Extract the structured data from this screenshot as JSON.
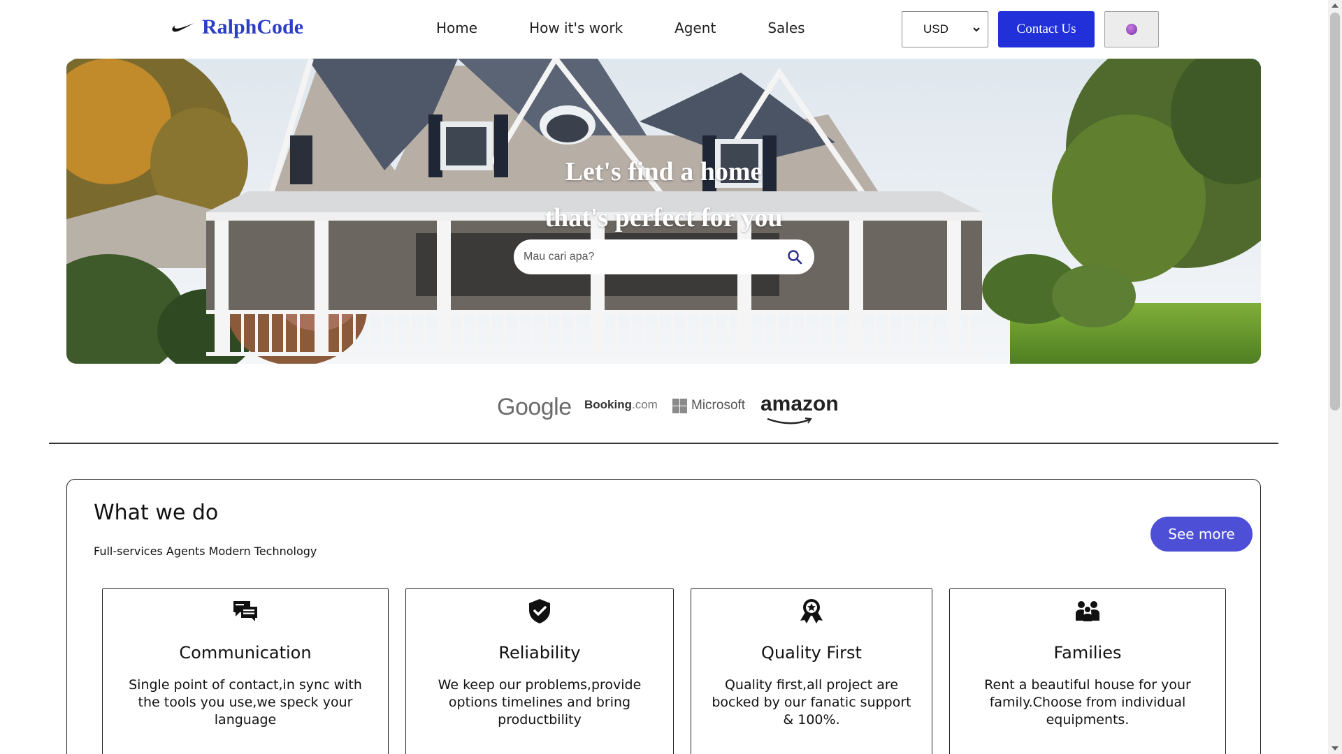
{
  "nav": {
    "brand": "RalphCode",
    "brand_icon": "swoosh-icon",
    "menu": [
      "Home",
      "How it's work",
      "Agent",
      "Sales"
    ],
    "currency": {
      "selected": "USD"
    },
    "contact_label": "Contact Us",
    "theme_icon": "globe-icon"
  },
  "hero": {
    "title_line1": "Let's find a home",
    "title_line2": "that's perfect for you",
    "search_placeholder": "Mau cari apa?",
    "search_icon": "search-icon"
  },
  "partners": {
    "google": "Google",
    "booking": "Booking",
    "booking_suffix": ".com",
    "microsoft": "Microsoft",
    "amazon": "amazon"
  },
  "services": {
    "title": "What we do",
    "subtitle": "Full-services Agents Modern Technology",
    "see_more": "See more",
    "cards": [
      {
        "icon": "chat-icon",
        "title": "Communication",
        "text": "Single point of contact,in sync with the tools you use,we speck your language"
      },
      {
        "icon": "shield-check-icon",
        "title": "Reliability",
        "text": "We keep our problems,provide options timelines and bring productbility"
      },
      {
        "icon": "award-icon",
        "title": "Quality First",
        "text": "Quality first,all project are bocked by our fanatic support & 100%."
      },
      {
        "icon": "family-icon",
        "title": "Families",
        "text": "Rent a beautiful house for your family.Choose from individual equipments."
      }
    ]
  },
  "colors": {
    "brand": "#2c3ec7",
    "primary_button": "#2130d9",
    "see_more": "#4d4fd6"
  }
}
